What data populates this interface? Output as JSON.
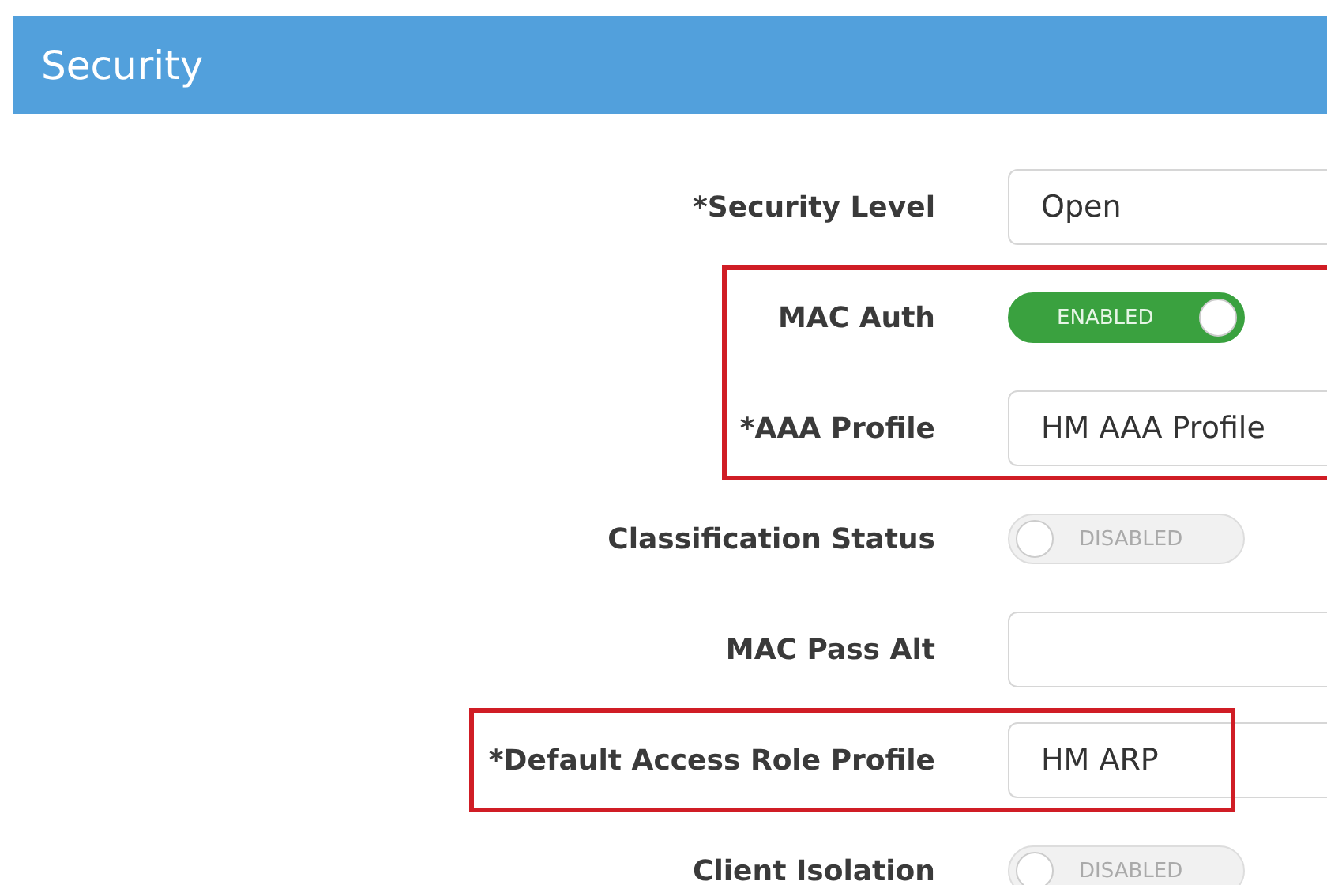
{
  "panel": {
    "title": "Security"
  },
  "groups": [
    {
      "highlighted": false,
      "rows": [
        {
          "kind": "field",
          "label": "*Security Level",
          "value": "Open"
        }
      ]
    },
    {
      "highlighted": true,
      "rows": [
        {
          "kind": "toggle",
          "label": "MAC Auth",
          "on": true,
          "state_text": "ENABLED"
        },
        {
          "kind": "field",
          "label": "*AAA Profile",
          "value": "HM AAA Profile"
        }
      ]
    },
    {
      "highlighted": false,
      "rows": [
        {
          "kind": "toggle",
          "label": "Classification Status",
          "on": false,
          "state_text": "DISABLED"
        },
        {
          "kind": "field",
          "label": "MAC Pass Alt",
          "value": ""
        }
      ]
    },
    {
      "highlighted": true,
      "rows": [
        {
          "kind": "field",
          "label": "*Default Access Role Profile",
          "value": "HM ARP"
        }
      ]
    },
    {
      "highlighted": false,
      "rows": [
        {
          "kind": "toggle",
          "label": "Client Isolation",
          "on": false,
          "state_text": "DISABLED"
        }
      ]
    }
  ]
}
